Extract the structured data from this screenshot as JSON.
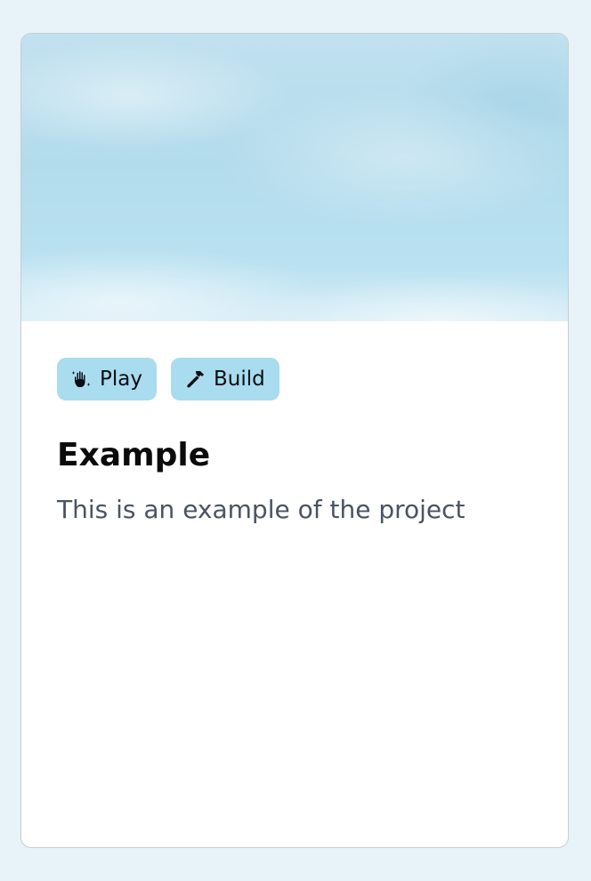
{
  "card": {
    "tags": [
      {
        "label": "Play",
        "icon": "hand-sparkle-icon"
      },
      {
        "label": "Build",
        "icon": "hammer-icon"
      }
    ],
    "title": "Example",
    "description": "This is an example of the project"
  },
  "colors": {
    "page_background": "#e8f2f9",
    "tag_background": "#a9dcee",
    "title": "#0b0b0b",
    "description": "#4b5363"
  }
}
